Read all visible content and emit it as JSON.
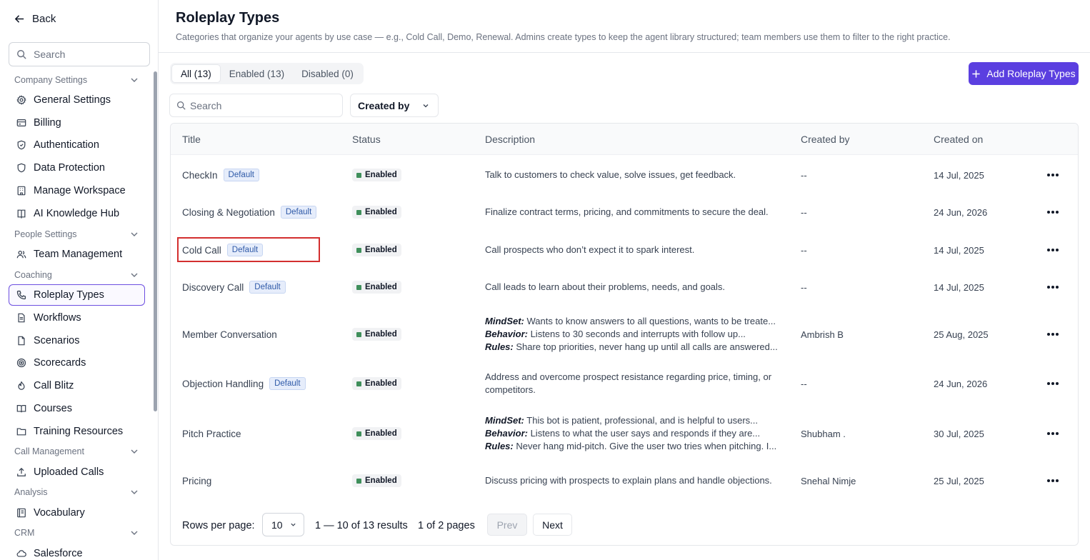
{
  "sidebar": {
    "back_label": "Back",
    "search_placeholder": "Search",
    "sections": {
      "company": "Company Settings",
      "people": "People Settings",
      "coaching": "Coaching",
      "call_management": "Call Management",
      "analysis": "Analysis",
      "crm": "CRM"
    },
    "items": {
      "general_settings": "General Settings",
      "billing": "Billing",
      "authentication": "Authentication",
      "data_protection": "Data Protection",
      "manage_workspace": "Manage Workspace",
      "ai_knowledge_hub": "AI Knowledge Hub",
      "team_management": "Team Management",
      "roleplay_types": "Roleplay Types",
      "workflows": "Workflows",
      "scenarios": "Scenarios",
      "scorecards": "Scorecards",
      "call_blitz": "Call Blitz",
      "courses": "Courses",
      "training_resources": "Training Resources",
      "uploaded_calls": "Uploaded Calls",
      "vocabulary": "Vocabulary",
      "salesforce": "Salesforce"
    },
    "active_item": "roleplay_types"
  },
  "header": {
    "title": "Roleplay Types",
    "subtitle": "Categories that organize your agents by use case — e.g., Cold Call, Demo, Renewal. Admins create types to keep the agent library structured; team members use them to filter to the right practice."
  },
  "tabs": [
    {
      "label": "All (13)",
      "active": true
    },
    {
      "label": "Enabled (13)",
      "active": false
    },
    {
      "label": "Disabled (0)",
      "active": false
    }
  ],
  "add_button_label": "Add Roleplay Types",
  "filters": {
    "search_placeholder": "Search",
    "created_by_label": "Created by"
  },
  "table": {
    "columns": {
      "title": "Title",
      "status": "Status",
      "description": "Description",
      "created_by": "Created by",
      "created_on": "Created on"
    },
    "default_badge": "Default",
    "status_text": "Enabled",
    "status_color": "#3f8f5b",
    "rows": [
      {
        "title": "CheckIn",
        "default": true,
        "status": "Enabled",
        "desc1": "Talk to customers to check value, solve issues, get feedback.",
        "created_by": "--",
        "created_on": "14 Jul, 2025"
      },
      {
        "title": "Closing & Negotiation",
        "default": true,
        "status": "Enabled",
        "desc1": "Finalize contract terms, pricing, and commitments to secure the deal.",
        "created_by": "--",
        "created_on": "24 Jun, 2026"
      },
      {
        "title": "Cold Call",
        "default": true,
        "status": "Enabled",
        "desc1": "Call prospects who don’t expect it to spark interest.",
        "created_by": "--",
        "created_on": "14 Jul, 2025"
      },
      {
        "title": "Discovery Call",
        "default": true,
        "status": "Enabled",
        "desc1": "Call leads to learn about their problems, needs, and goals.",
        "created_by": "--",
        "created_on": "14 Jul, 2025"
      },
      {
        "title": "Member Conversation",
        "default": false,
        "status": "Enabled",
        "mindset_label": "MindSet:",
        "mindset": " Wants to know answers to all questions, wants to be treate...",
        "behavior_label": "Behavior:",
        "behavior": " Listens to 30 seconds and interrupts with follow up...",
        "rules_label": "Rules:",
        "rules": " Share top priorities, never hang up until all calls are answered...",
        "created_by": "Ambrish B",
        "created_on": "25 Aug, 2025"
      },
      {
        "title": "Objection Handling",
        "default": true,
        "status": "Enabled",
        "desc1": "Address and overcome prospect resistance regarding price, timing, or",
        "desc2": "competitors.",
        "created_by": "--",
        "created_on": "24 Jun, 2026"
      },
      {
        "title": "Pitch Practice",
        "default": false,
        "status": "Enabled",
        "mindset_label": "MindSet:",
        "mindset": " This bot is patient, professional, and is helpful to users...",
        "behavior_label": "Behavior:",
        "behavior": " Listens to what the user says and responds if they are...",
        "rules_label": "Rules:",
        "rules": " Never hang mid-pitch. Give the user two tries when pitching. I...",
        "created_by": "Shubham .",
        "created_on": "30 Jul, 2025"
      },
      {
        "title": "Pricing",
        "default": false,
        "status": "Enabled",
        "desc1": "Discuss pricing with prospects to explain plans and handle objections.",
        "created_by": "Snehal Nimje",
        "created_on": "25 Jul, 2025"
      }
    ]
  },
  "pagination": {
    "rows_per_page_label": "Rows per page:",
    "rows_per_page_value": "10",
    "range_text": "1 — 10 of 13 results",
    "pages_text": "1 of 2 pages",
    "prev_label": "Prev",
    "next_label": "Next"
  },
  "accent_color": "#5b3fe0",
  "highlight_color": "#d32f2f"
}
